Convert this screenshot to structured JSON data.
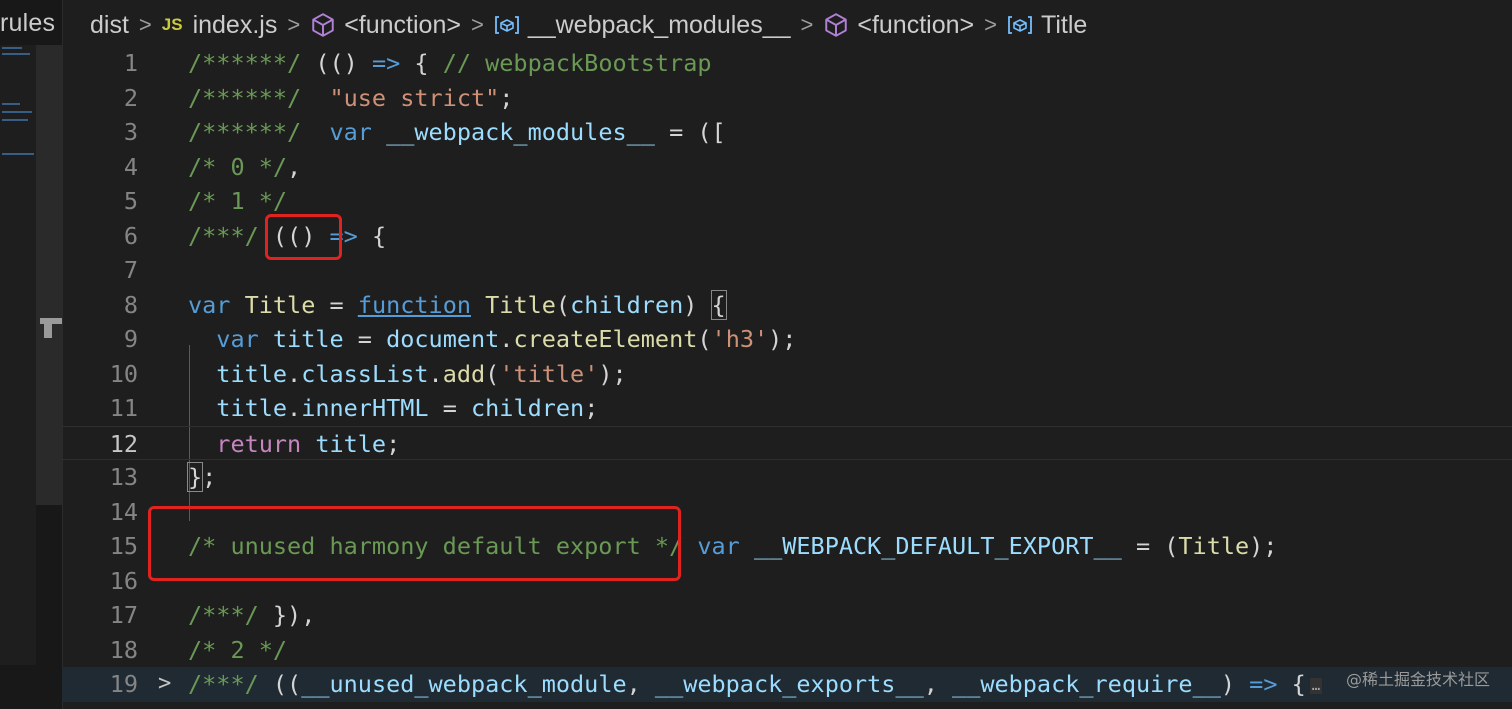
{
  "explorer": {
    "label": "rules"
  },
  "breadcrumb": {
    "items": [
      {
        "label": "dist",
        "icon": ""
      },
      {
        "label": "index.js",
        "icon": "js-file-icon",
        "badge": "JS"
      },
      {
        "label": "<function>",
        "icon": "function-cube-icon"
      },
      {
        "label": "__webpack_modules__",
        "icon": "variable-icon"
      },
      {
        "label": "<function>",
        "icon": "function-cube-icon"
      },
      {
        "label": "Title",
        "icon": "variable-icon"
      }
    ],
    "separator": ">"
  },
  "editor": {
    "current_line": 12,
    "lines": [
      {
        "n": "1",
        "tokens": [
          [
            "/******/",
            "com"
          ],
          [
            " ",
            "op"
          ],
          [
            "(() ",
            "op"
          ],
          [
            "=>",
            "kw"
          ],
          [
            " { ",
            "op"
          ],
          [
            "// webpackBootstrap",
            "com"
          ]
        ]
      },
      {
        "n": "2",
        "tokens": [
          [
            "/******/",
            "com"
          ],
          [
            "  ",
            "op"
          ],
          [
            "\"use strict\"",
            "str"
          ],
          [
            ";",
            "op"
          ]
        ]
      },
      {
        "n": "3",
        "tokens": [
          [
            "/******/",
            "com"
          ],
          [
            "  ",
            "op"
          ],
          [
            "var",
            "kw"
          ],
          [
            " ",
            "op"
          ],
          [
            "__webpack_modules__",
            "var"
          ],
          [
            " = ([",
            "op"
          ]
        ]
      },
      {
        "n": "4",
        "tokens": [
          [
            "/* 0 */",
            "com"
          ],
          [
            ",",
            "op"
          ]
        ]
      },
      {
        "n": "5",
        "tokens": [
          [
            "/* 1 */",
            "com"
          ]
        ]
      },
      {
        "n": "6",
        "tokens": [
          [
            "/***/",
            "com"
          ],
          [
            " (() ",
            "op"
          ],
          [
            "=>",
            "kw"
          ],
          [
            " {",
            "op"
          ]
        ]
      },
      {
        "n": "7",
        "tokens": []
      },
      {
        "n": "8",
        "tokens": [
          [
            "var",
            "kw"
          ],
          [
            " ",
            "op"
          ],
          [
            "Title",
            "fn"
          ],
          [
            " = ",
            "op"
          ],
          [
            "function",
            "link"
          ],
          [
            " ",
            "op"
          ],
          [
            "Title",
            "fn"
          ],
          [
            "(",
            "op"
          ],
          [
            "children",
            "var"
          ],
          [
            ") ",
            "op"
          ],
          [
            "{",
            "brk"
          ]
        ]
      },
      {
        "n": "9",
        "tokens": [
          [
            "  ",
            "op"
          ],
          [
            "var",
            "kw"
          ],
          [
            " ",
            "op"
          ],
          [
            "title",
            "var"
          ],
          [
            " = ",
            "op"
          ],
          [
            "document",
            "var"
          ],
          [
            ".",
            "op"
          ],
          [
            "createElement",
            "fn"
          ],
          [
            "(",
            "op"
          ],
          [
            "'h3'",
            "str"
          ],
          [
            ");",
            "op"
          ]
        ]
      },
      {
        "n": "10",
        "tokens": [
          [
            "  ",
            "op"
          ],
          [
            "title",
            "var"
          ],
          [
            ".",
            "op"
          ],
          [
            "classList",
            "var"
          ],
          [
            ".",
            "op"
          ],
          [
            "add",
            "fn"
          ],
          [
            "(",
            "op"
          ],
          [
            "'title'",
            "str"
          ],
          [
            ");",
            "op"
          ]
        ]
      },
      {
        "n": "11",
        "tokens": [
          [
            "  ",
            "op"
          ],
          [
            "title",
            "var"
          ],
          [
            ".",
            "op"
          ],
          [
            "innerHTML",
            "var"
          ],
          [
            " = ",
            "op"
          ],
          [
            "children",
            "var"
          ],
          [
            ";",
            "op"
          ]
        ]
      },
      {
        "n": "12",
        "tokens": [
          [
            "  ",
            "op"
          ],
          [
            "return",
            "ctrl"
          ],
          [
            " ",
            "op"
          ],
          [
            "title",
            "var"
          ],
          [
            ";",
            "op"
          ]
        ]
      },
      {
        "n": "13",
        "tokens": [
          [
            "}",
            "brk"
          ],
          [
            ";",
            "op"
          ]
        ]
      },
      {
        "n": "14",
        "tokens": []
      },
      {
        "n": "15",
        "tokens": [
          [
            "/* unused harmony default export */",
            "com"
          ],
          [
            " ",
            "op"
          ],
          [
            "var",
            "kw"
          ],
          [
            " ",
            "op"
          ],
          [
            "__WEBPACK_DEFAULT_EXPORT__",
            "var"
          ],
          [
            " = (",
            "op"
          ],
          [
            "Title",
            "fn"
          ],
          [
            ");",
            "op"
          ]
        ]
      },
      {
        "n": "16",
        "tokens": []
      },
      {
        "n": "17",
        "tokens": [
          [
            "/***/",
            "com"
          ],
          [
            " }),",
            "op"
          ]
        ]
      },
      {
        "n": "18",
        "tokens": [
          [
            "/* 2 */",
            "com"
          ]
        ]
      },
      {
        "n": "19",
        "tokens": [
          [
            "/***/",
            "com"
          ],
          [
            " ((",
            "op"
          ],
          [
            "__unused_webpack_module",
            "var"
          ],
          [
            ", ",
            "op"
          ],
          [
            "__webpack_exports__",
            "var"
          ],
          [
            ", ",
            "op"
          ],
          [
            "__webpack_require__",
            "var"
          ],
          [
            ") ",
            "op"
          ],
          [
            "=>",
            "kw"
          ],
          [
            " {",
            "op"
          ]
        ],
        "folded": true,
        "fold_glyph": ">",
        "ellipsis": "…"
      }
    ]
  },
  "annotation_color": "#e0231f",
  "watermark": "@稀土掘金技术社区"
}
